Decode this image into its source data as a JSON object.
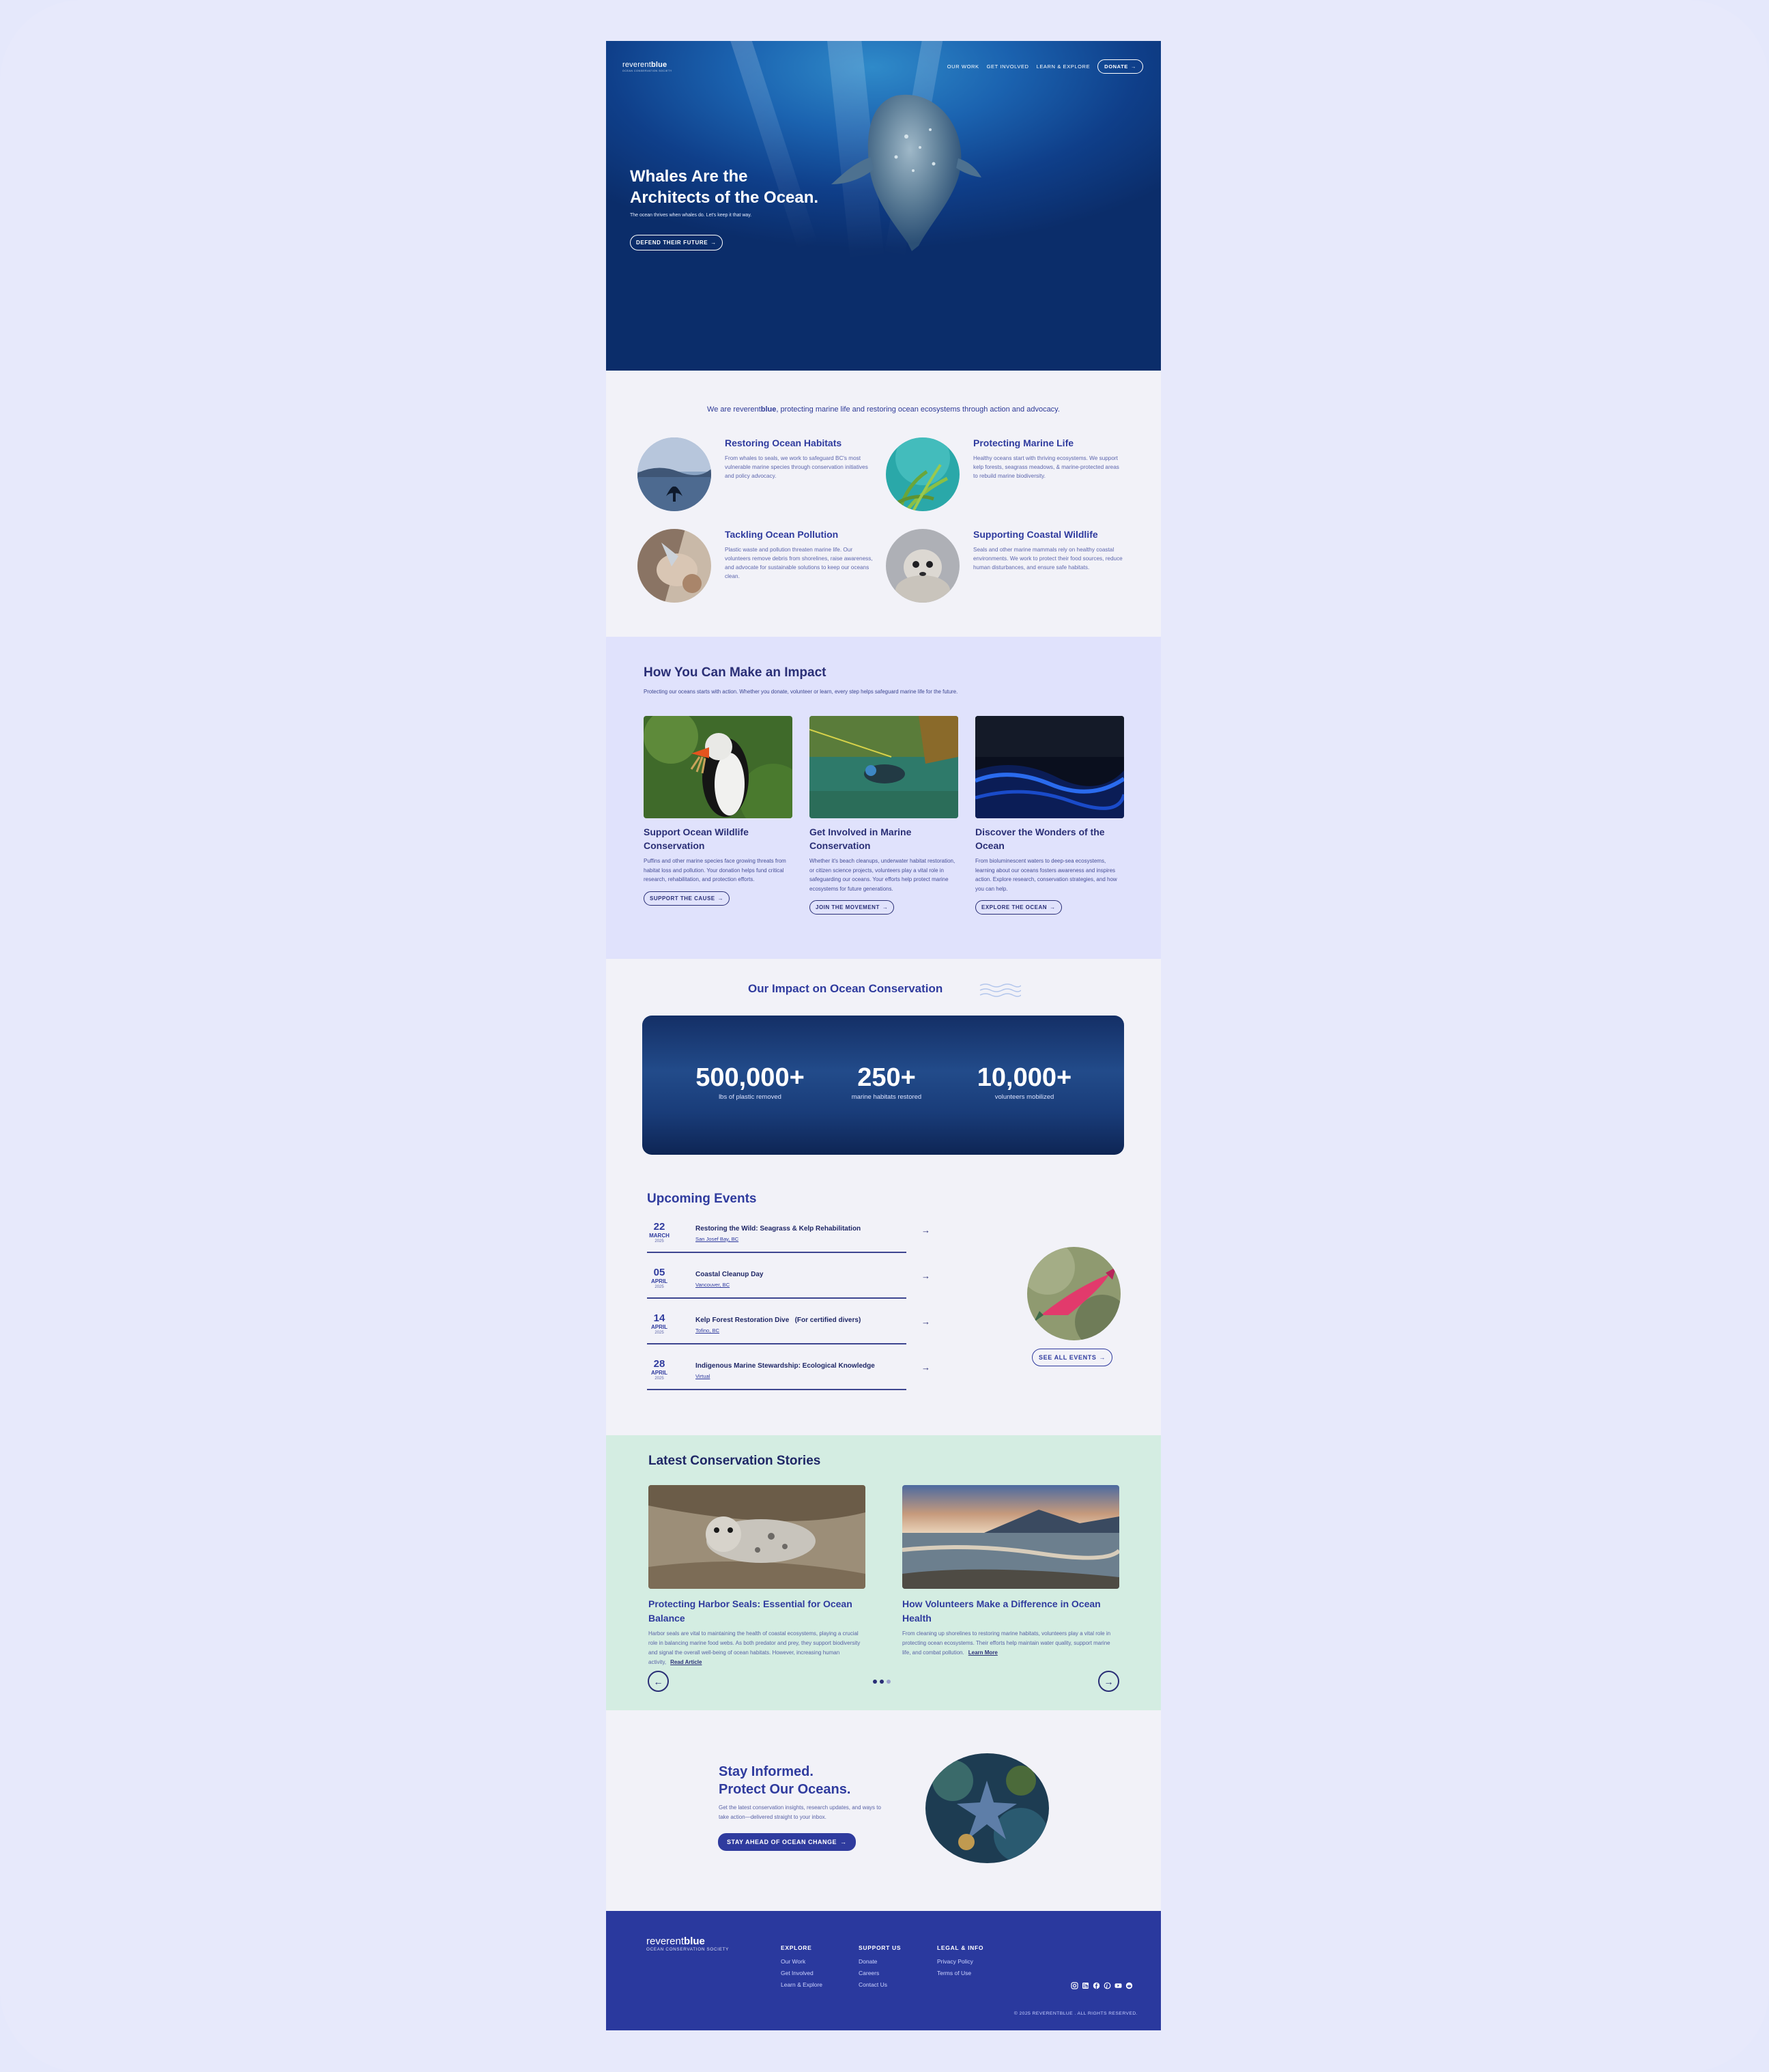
{
  "brand": {
    "name_light": "reverent",
    "name_bold": "blue",
    "tagline": "OCEAN CONSERVATION SOCIETY"
  },
  "nav": {
    "items": [
      "OUR WORK",
      "GET INVOLVED",
      "LEARN & EXPLORE"
    ],
    "donate": "DONATE",
    "arrow": "→"
  },
  "hero": {
    "title_line1": "Whales Are the",
    "title_line2": "Architects of the Ocean.",
    "tagline": "The ocean thrives when whales do. Let's keep it that way.",
    "cta": "DEFEND THEIR FUTURE"
  },
  "intro": {
    "lead_before": "We are reverent",
    "lead_bold": "blue",
    "lead_after": ", protecting marine life and restoring ocean ecosystems through action and advocacy."
  },
  "features": [
    {
      "title": "Restoring Ocean Habitats",
      "text": "From whales to seals, we work to safeguard BC's most vulnerable marine species through conservation initiatives and policy advocacy."
    },
    {
      "title": "Protecting Marine Life",
      "text": "Healthy oceans start with thriving ecosystems. We support kelp forests, seagrass meadows, & marine-protected areas to rebuild marine biodiversity."
    },
    {
      "title": "Tackling Ocean Pollution",
      "text": "Plastic waste and pollution threaten marine life. Our volunteers remove debris from shorelines, raise awareness, and advocate for sustainable solutions to keep our oceans clean."
    },
    {
      "title": "Supporting Coastal Wildlife",
      "text": "Seals and other marine mammals rely on healthy coastal environments. We work to protect their food sources, reduce human disturbances, and ensure safe habitats."
    }
  ],
  "impact": {
    "title": "How You Can Make an Impact",
    "subtitle": "Protecting our oceans starts with action. Whether you donate, volunteer or learn, every step helps safeguard marine life for the future.",
    "cards": [
      {
        "title": "Support Ocean Wildlife Conservation",
        "text": "Puffins and other marine species face growing threats from habitat loss and pollution. Your donation helps fund critical research, rehabilitation, and protection efforts.",
        "cta": "SUPPORT THE CAUSE"
      },
      {
        "title": "Get Involved in Marine Conservation",
        "text": "Whether it's beach cleanups, underwater habitat restoration, or citizen science projects, volunteers play a vital role in safeguarding our oceans. Your efforts help protect marine ecosystems for future generations.",
        "cta": "JOIN THE MOVEMENT"
      },
      {
        "title": "Discover the Wonders of the Ocean",
        "text": "From bioluminescent waters to deep-sea ecosystems, learning about our oceans fosters awareness and inspires action. Explore research, conservation strategies, and how you can help.",
        "cta": "EXPLORE THE OCEAN"
      }
    ]
  },
  "stats": {
    "title": "Our Impact on Ocean Conservation",
    "items": [
      {
        "value": "500,000+",
        "label": "lbs of plastic removed"
      },
      {
        "value": "250+",
        "label": "marine habitats restored"
      },
      {
        "value": "10,000+",
        "label": "volunteers mobilized"
      }
    ]
  },
  "events": {
    "title": "Upcoming Events",
    "items": [
      {
        "day": "22",
        "month": "MARCH",
        "year": "2025",
        "title": "Restoring the Wild: Seagrass & Kelp Rehabilitation",
        "location": "San Josef Bay, BC"
      },
      {
        "day": "05",
        "month": "APRIL",
        "year": "2025",
        "title": "Coastal Cleanup Day",
        "location": "Vancouver, BC"
      },
      {
        "day": "14",
        "month": "APRIL",
        "year": "2025",
        "title": "Kelp Forest Restoration Dive   (For certified divers)",
        "location": "Tofino, BC"
      },
      {
        "day": "28",
        "month": "APRIL",
        "year": "2025",
        "title": "Indigenous Marine Stewardship: Ecological Knowledge",
        "location": "Virtual"
      }
    ],
    "see_all": "SEE ALL EVENTS"
  },
  "stories": {
    "title": "Latest Conservation Stories",
    "items": [
      {
        "title": "Protecting Harbor Seals: Essential for Ocean Balance",
        "text": "Harbor seals are vital to maintaining the health of coastal ecosystems, playing a crucial role in balancing marine food webs. As both predator and prey, they support biodiversity and signal the overall well-being of ocean habitats. However, increasing human activity,",
        "link": "Read Article"
      },
      {
        "title": "How Volunteers Make a Difference in Ocean Health",
        "text": "From cleaning up shorelines to restoring marine habitats, volunteers play a vital role in protecting ocean ecosystems. Their efforts help maintain water quality, support marine life, and combat pollution.",
        "link": "Learn More"
      }
    ],
    "prev": "←",
    "next": "→",
    "active_slide": 2,
    "slide_count": 3
  },
  "newsletter": {
    "title_line1": "Stay Informed.",
    "title_line2": "Protect Our Oceans.",
    "text": "Get the latest conservation insights, research updates, and ways to take action—delivered straight to your inbox.",
    "cta": "STAY AHEAD OF OCEAN CHANGE"
  },
  "footer": {
    "columns": [
      {
        "heading": "EXPLORE",
        "items": [
          "Our Work",
          "Get Involved",
          "Learn & Explore"
        ]
      },
      {
        "heading": "SUPPORT US",
        "items": [
          "Donate",
          "Careers",
          "Contact Us"
        ]
      },
      {
        "heading": "LEGAL & INFO",
        "items": [
          "Privacy Policy",
          "Terms of Use"
        ]
      }
    ],
    "social_icons": [
      "instagram-icon",
      "linkedin-icon",
      "facebook-icon",
      "pinterest-icon",
      "youtube-icon",
      "reddit-icon"
    ],
    "copyright": "© 2025 REVERENTBLUE . ALL RIGHTS RESERVED."
  },
  "colors": {
    "brand_blue": "#2a399e",
    "navy": "#2a2f76",
    "lavender": "#e0e2fc",
    "mint": "#d4ede2",
    "page_bg": "#f2f2f8"
  }
}
